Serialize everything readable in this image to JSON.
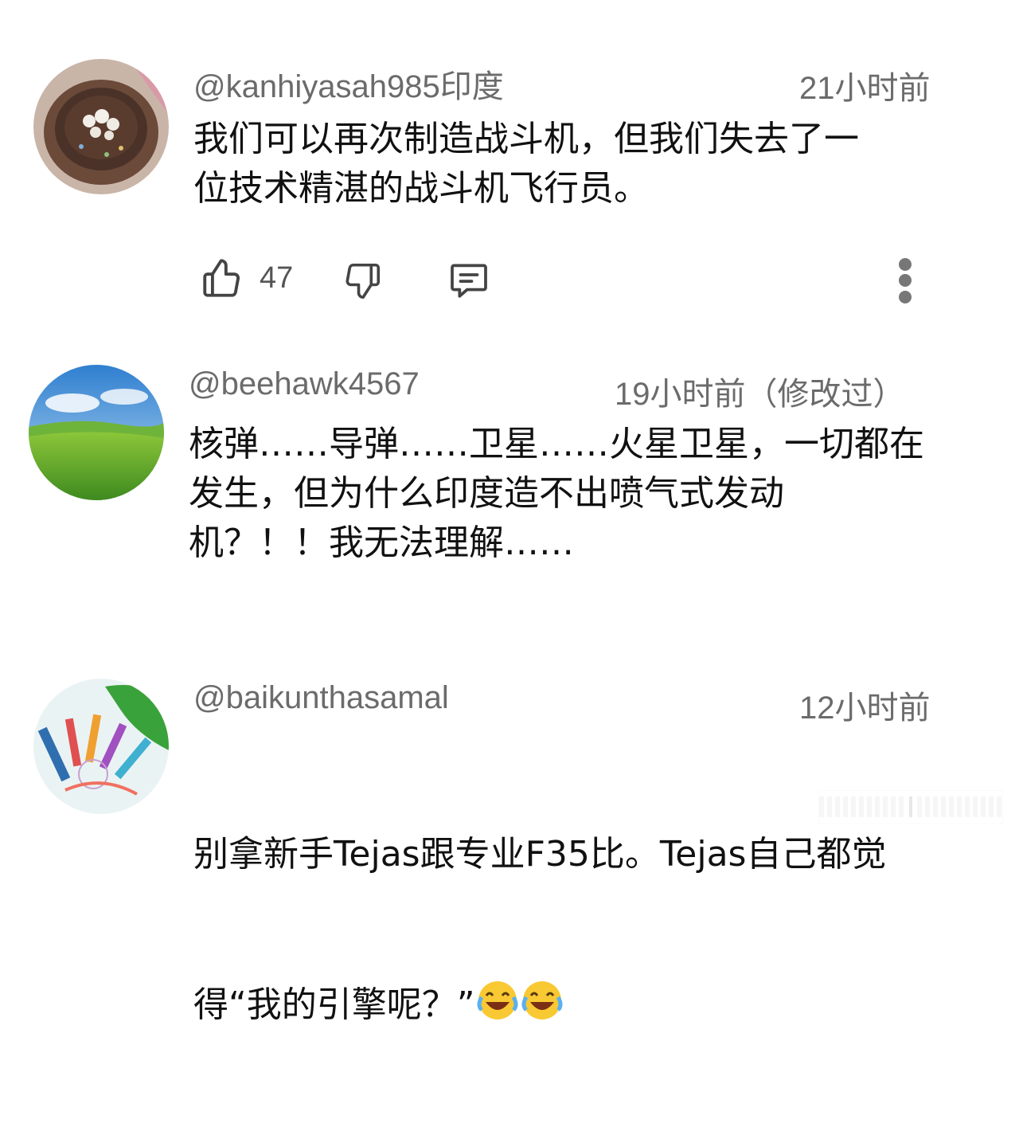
{
  "comments": [
    {
      "username": "@kanhiyasah985印度",
      "time": "21小时前",
      "text": "我们可以再次制造战斗机，但我们失去了一\n位技术精湛的战斗机飞行员。",
      "likes": "47",
      "avatar": "cake-photo-avatar"
    },
    {
      "username": "@beehawk4567",
      "time": "19小时前（修改过）",
      "text": "核弹……导弹……卫星……火星卫星，一切都在\n发生，但为什么印度造不出喷气式发动\n机？！！我无法理解……",
      "avatar": "green-field-avatar"
    },
    {
      "username": "@baikunthasamal",
      "time": "12小时前",
      "text_line1": "别拿新手Tejas跟专业F35比。Tejas自己都觉",
      "text_line2": "得“我的引擎呢？”",
      "emoji": [
        "face-with-tears-of-joy-emoji",
        "face-with-tears-of-joy-emoji"
      ],
      "avatar": "colored-pencils-avatar"
    }
  ],
  "icons": {
    "like": "thumbs-up-icon",
    "dislike": "thumbs-down-icon",
    "reply": "reply-comment-icon",
    "more": "more-vertical-icon"
  }
}
